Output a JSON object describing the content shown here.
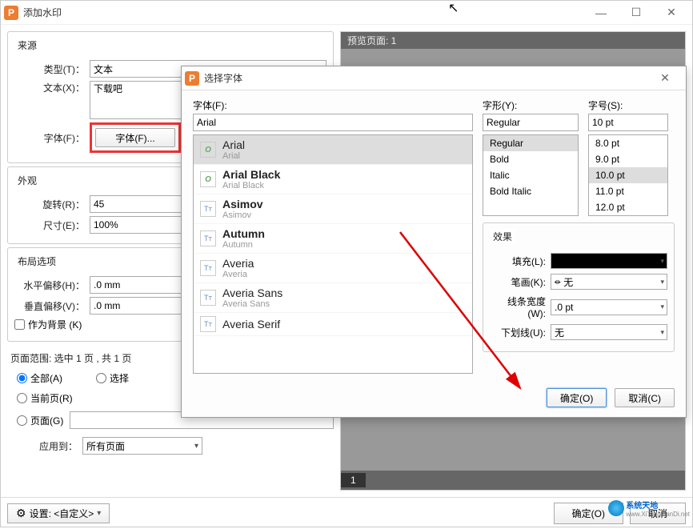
{
  "main": {
    "title": "添加水印",
    "source": {
      "group": "来源",
      "type_label": "类型(T)：",
      "type_value": "文本",
      "text_label": "文本(X)：",
      "text_value": "下载吧",
      "font_label": "字体(F)：",
      "font_btn": "字体(F)..."
    },
    "appearance": {
      "group": "外观",
      "rotate_label": "旋转(R)：",
      "rotate_value": "45",
      "size_label": "尺寸(E)：",
      "size_value": "100%"
    },
    "layout": {
      "group": "布局选项",
      "hoffset_label": "水平偏移(H)：",
      "hoffset_value": ".0 mm",
      "voffset_label": "垂直偏移(V)：",
      "voffset_value": ".0 mm",
      "as_bg": "作为背景 (K)"
    },
    "range": {
      "label": "页面范围: 选中 1 页 , 共 1 页",
      "all": "全部(A)",
      "select": "选择",
      "current": "当前页(R)",
      "pages": "页面(G)",
      "apply_label": "应用到：",
      "apply_value": "所有页面"
    },
    "preview_header": "预览页面: 1",
    "page_num": "1",
    "settings": "设置: <自定义>",
    "ok": "确定(O)",
    "cancel": "取消"
  },
  "dialog": {
    "title": "选择字体",
    "font_label": "字体(F):",
    "font_value": "Arial",
    "style_label": "字形(Y):",
    "style_value": "Regular",
    "size_label": "字号(S):",
    "size_value": "10 pt",
    "fonts": [
      {
        "name": "Arial",
        "sub": "Arial",
        "type": "o",
        "selected": true
      },
      {
        "name": "Arial Black",
        "sub": "Arial Black",
        "type": "o",
        "bold": true
      },
      {
        "name": "Asimov",
        "sub": "Asimov",
        "type": "t",
        "bold": true
      },
      {
        "name": "Autumn",
        "sub": "Autumn",
        "type": "t",
        "bold": true
      },
      {
        "name": "Averia",
        "sub": "Averia",
        "type": "t"
      },
      {
        "name": "Averia Sans",
        "sub": "Averia Sans",
        "type": "t"
      },
      {
        "name": "Averia Serif",
        "sub": "",
        "type": "t"
      }
    ],
    "styles": [
      "Regular",
      "Bold",
      "Italic",
      "Bold Italic"
    ],
    "style_selected": "Regular",
    "sizes": [
      "8.0 pt",
      "9.0 pt",
      "10.0 pt",
      "11.0 pt",
      "12.0 pt"
    ],
    "size_selected": "10.0 pt",
    "effects": {
      "group": "效果",
      "fill": "填充(L):",
      "stroke": "笔画(K):",
      "stroke_value": "无",
      "linewidth": "线条宽度(W):",
      "linewidth_value": ".0 pt",
      "underline": "下划线(U):",
      "underline_value": "无"
    },
    "ok": "确定(O)",
    "cancel": "取消(C)"
  },
  "logo": {
    "text1": "系统天地",
    "text2": "www.XiTongTianDi.net"
  }
}
